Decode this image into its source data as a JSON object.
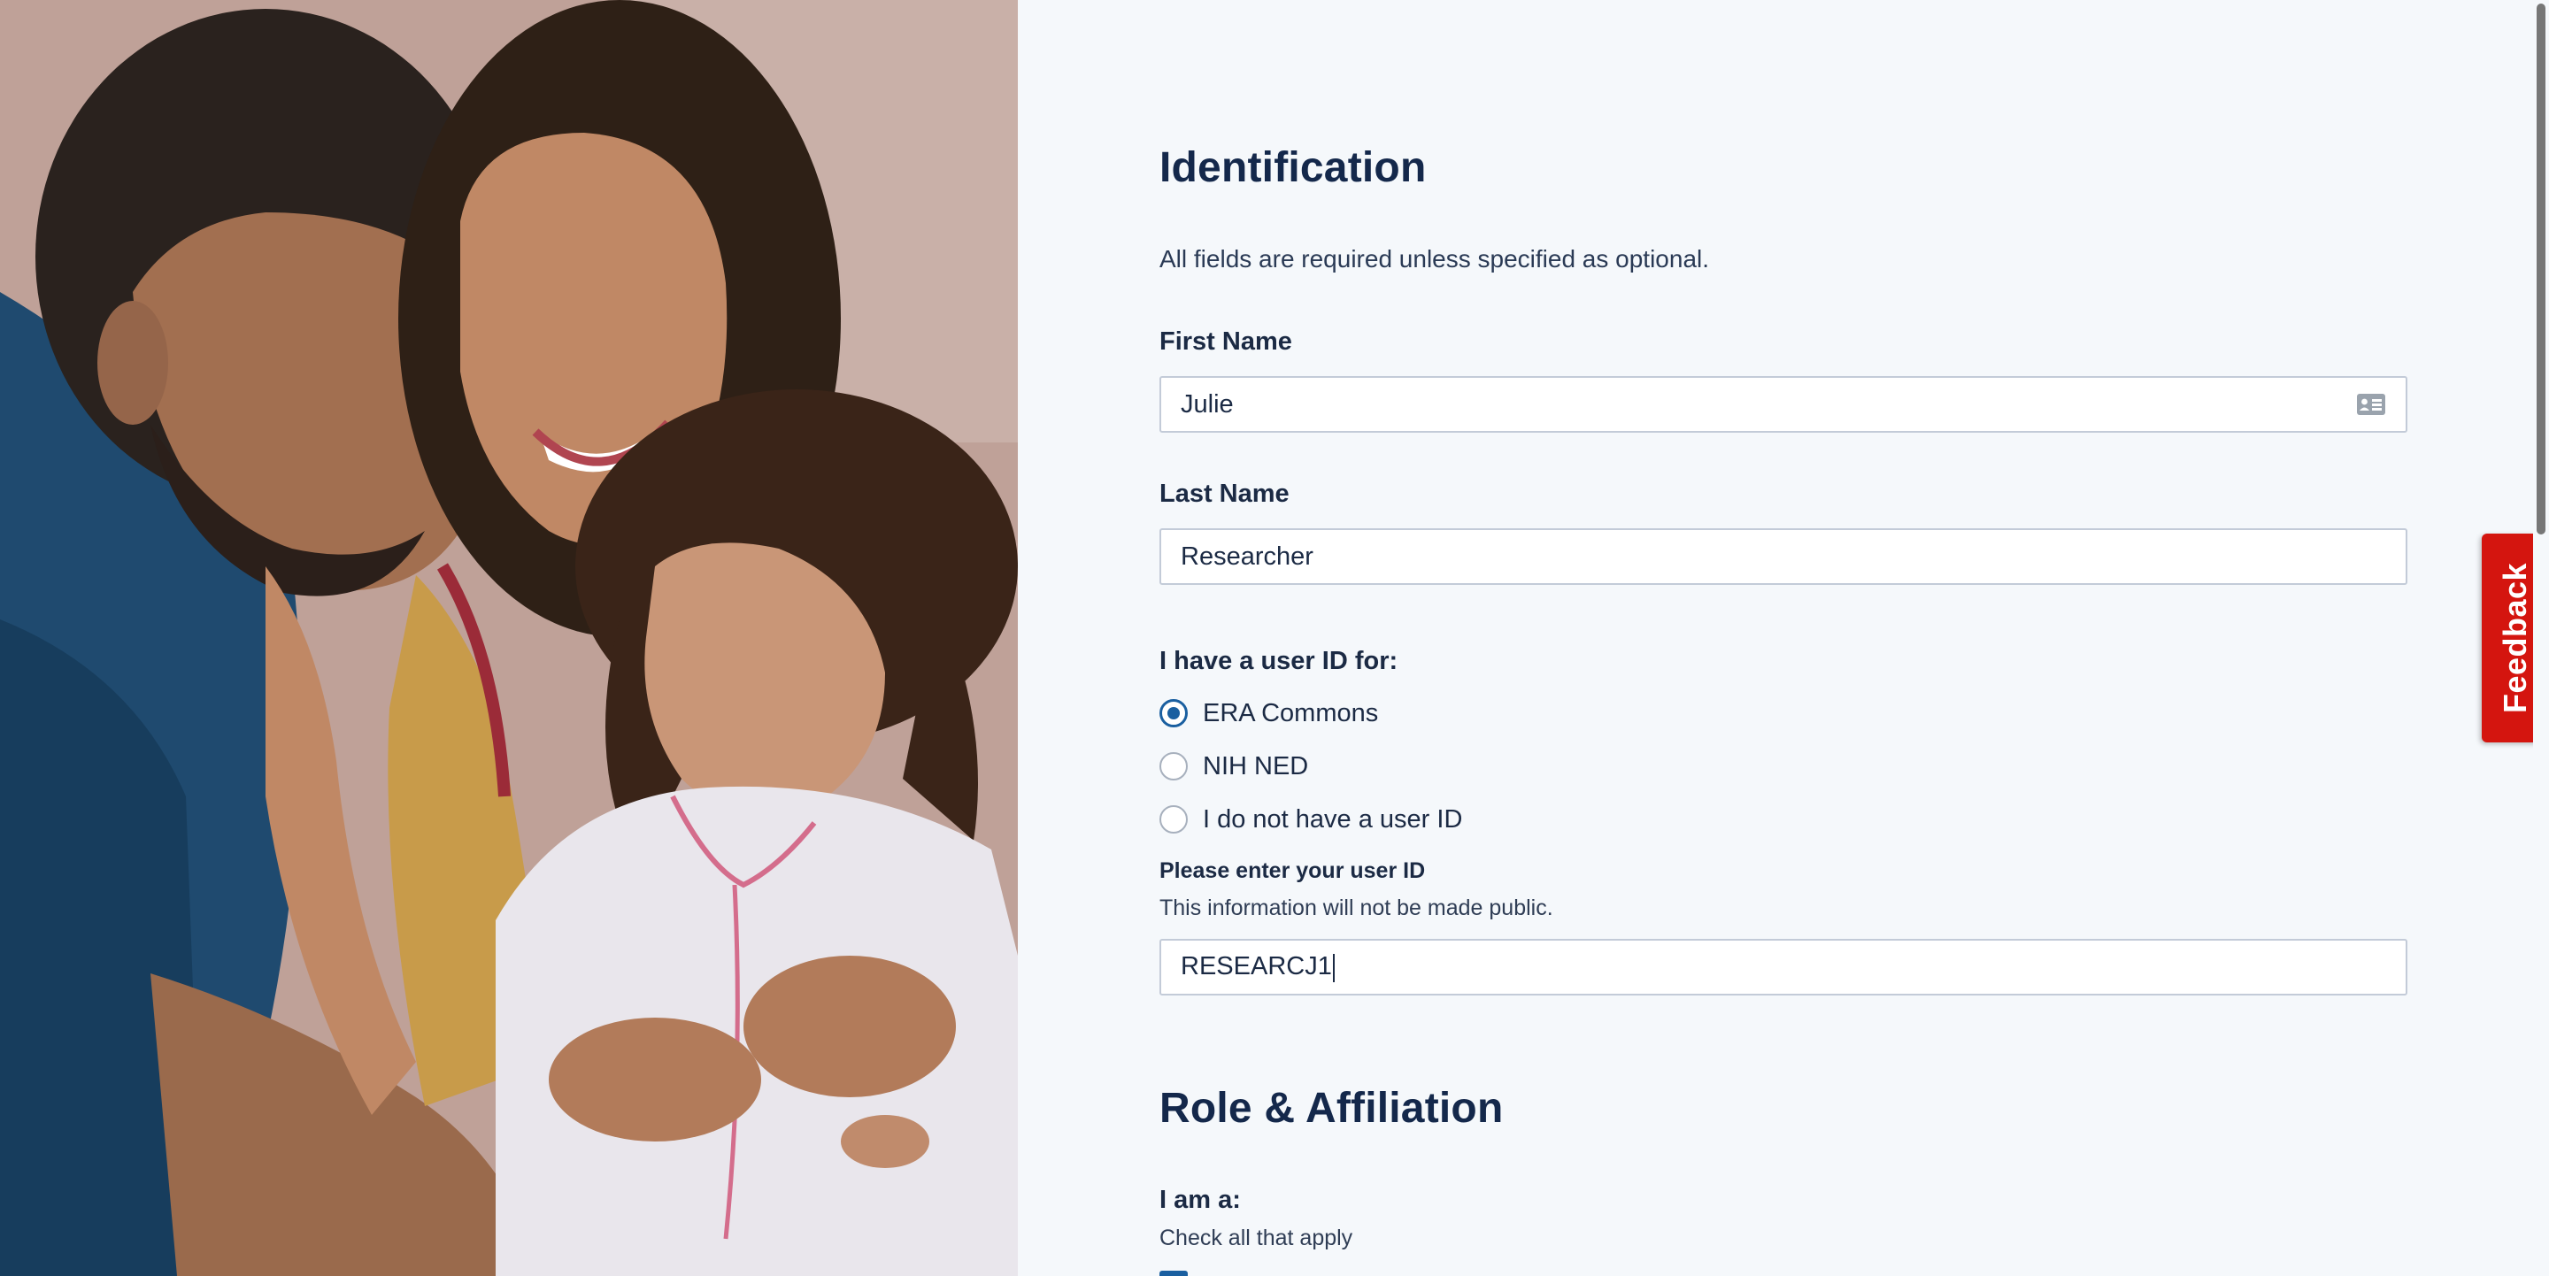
{
  "identification": {
    "heading": "Identification",
    "intro": "All fields are required unless specified as optional.",
    "first_name": {
      "label": "First Name",
      "value": "Julie"
    },
    "last_name": {
      "label": "Last Name",
      "value": "Researcher"
    },
    "user_id_group": {
      "label": "I have a user ID for:",
      "options": [
        {
          "label": "ERA Commons",
          "checked": true
        },
        {
          "label": "NIH NED",
          "checked": false
        },
        {
          "label": "I do not have a user ID",
          "checked": false
        }
      ]
    },
    "user_id": {
      "label": "Please enter your user ID",
      "help": "This information will not be made public.",
      "value": "RESEARCJ1"
    }
  },
  "role_affiliation": {
    "heading": "Role & Affiliation",
    "i_am_label": "I am a:",
    "help": "Check all that apply"
  },
  "feedback": {
    "label": "Feedback"
  },
  "icons": {
    "first_name_field": "contact-card-icon"
  },
  "colors": {
    "heading": "#14284b",
    "radio_checked": "#1a5fa0",
    "feedback_tab": "#d4150f",
    "page_bg": "#f5f8fb"
  }
}
